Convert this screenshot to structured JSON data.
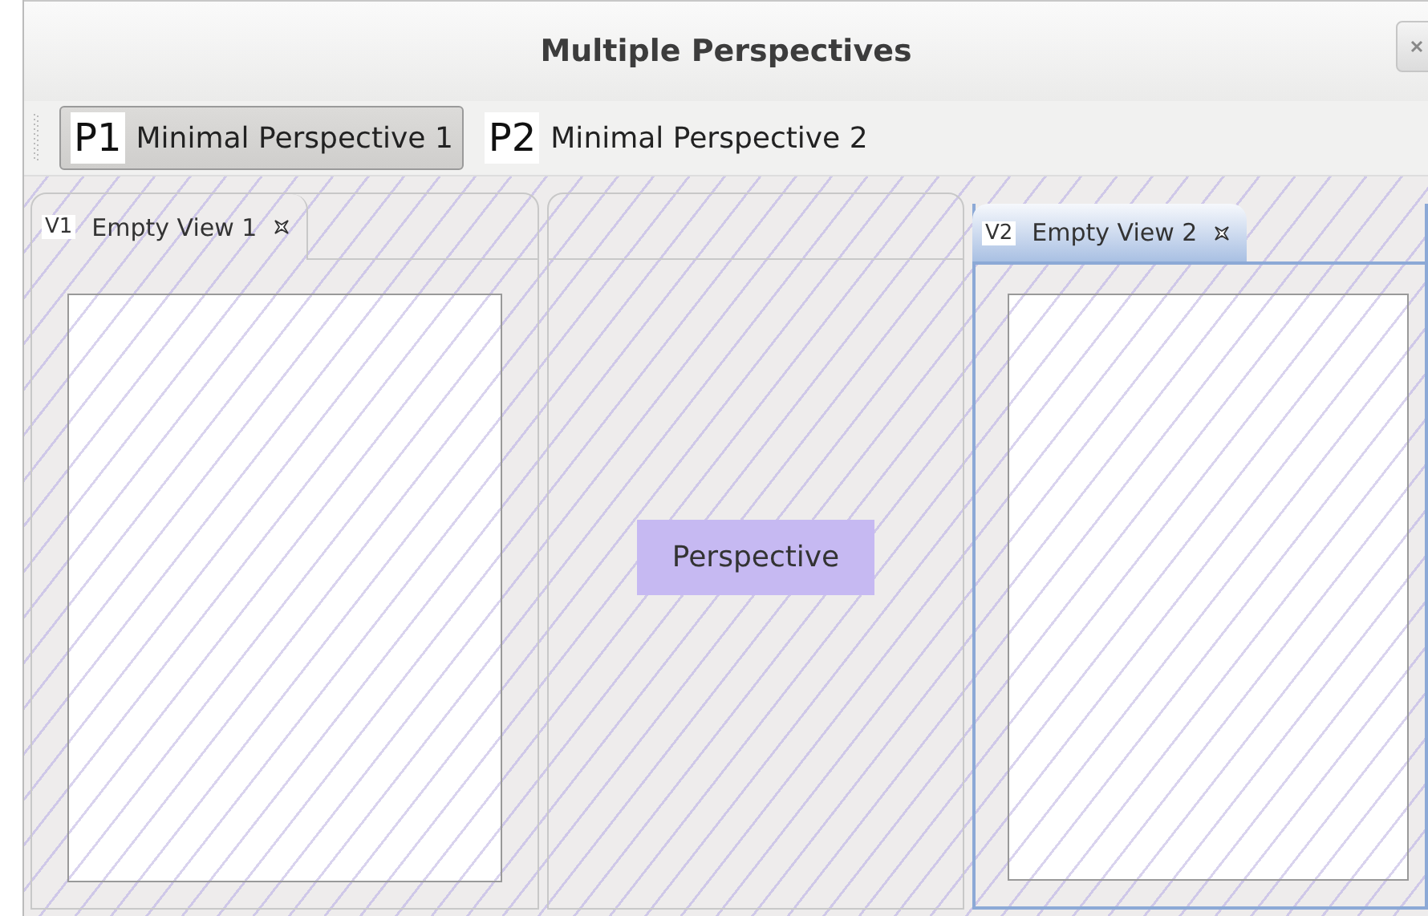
{
  "window": {
    "title": "Multiple Perspectives"
  },
  "perspective_switcher": [
    {
      "badge": "P1",
      "label": "Minimal Perspective 1",
      "selected": true
    },
    {
      "badge": "P2",
      "label": "Minimal Perspective 2",
      "selected": false
    }
  ],
  "parts": [
    {
      "kind": "view_stack",
      "active": false,
      "tabs": [
        {
          "badge": "V1",
          "label": "Empty View 1",
          "selected": true
        }
      ]
    },
    {
      "kind": "editor_area",
      "label": "Perspective"
    },
    {
      "kind": "view_stack",
      "active": true,
      "tabs": [
        {
          "badge": "V2",
          "label": "Empty View 2",
          "selected": true
        }
      ]
    }
  ]
}
